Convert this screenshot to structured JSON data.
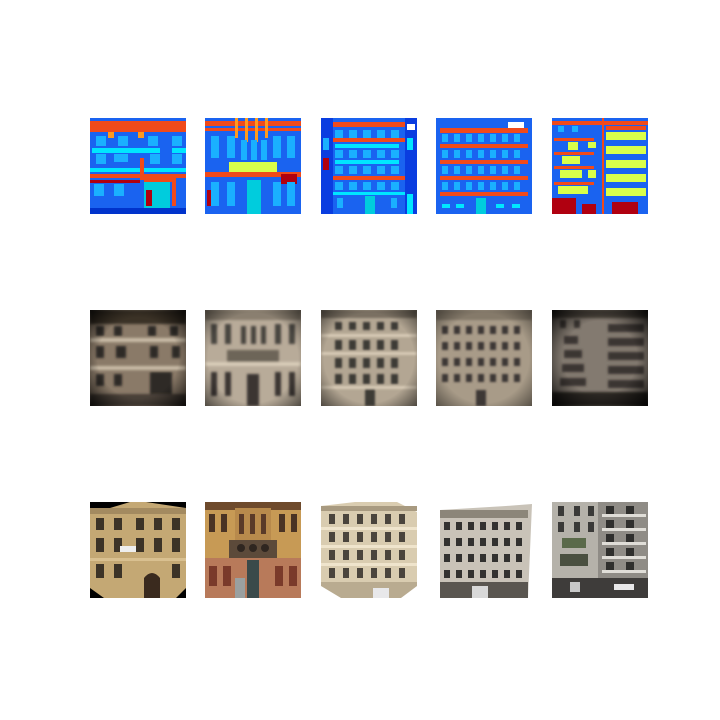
{
  "figure": {
    "rows": [
      "label-maps",
      "generated-photos",
      "real-photos"
    ],
    "columns": 5
  },
  "colors": {
    "background": "#ffffff",
    "label_wall": "#1a63f0",
    "label_window": "#1ab0ff",
    "label_ledge": "#00e6ff",
    "label_cornice": "#f04a1a",
    "label_balcony": "#d9ff4a",
    "label_door": "#00ccdd",
    "label_shop": "#b00010",
    "label_deco": "#ff9a20"
  }
}
